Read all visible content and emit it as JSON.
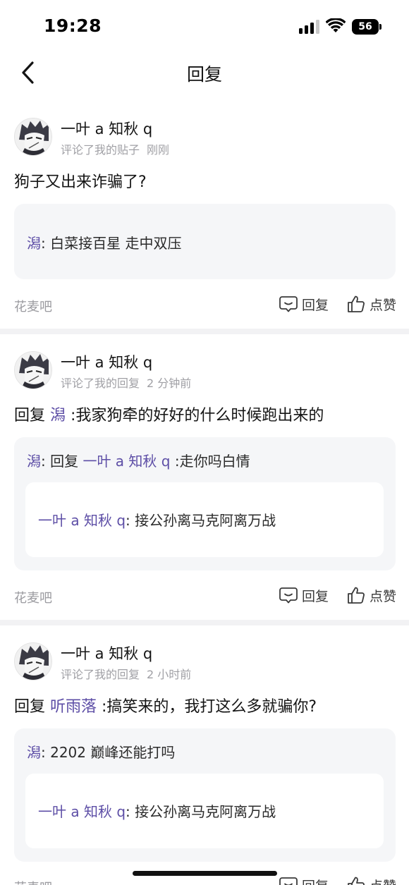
{
  "status_bar": {
    "time": "19:28",
    "battery": "56"
  },
  "nav": {
    "title": "回复"
  },
  "notifications": [
    {
      "username": "一叶 a 知秋 q",
      "action": "评论了我的贴子",
      "time": "刚刚",
      "content_text": "狗子又出来诈骗了?",
      "quote": {
        "author": "潟",
        "text": ": 白菜接百星 走中双压"
      },
      "forum": "花麦吧",
      "reply_label": "回复",
      "like_label": "点赞"
    },
    {
      "username": "一叶 a 知秋 q",
      "action": "评论了我的回复",
      "time": "2 分钟前",
      "content_prefix": "回复 ",
      "content_mention": "潟",
      "content_text": " :我家狗牵的好好的什么时候跑出来的",
      "quote": {
        "author": "潟",
        "prefix": ": 回复 ",
        "mention": "一叶 a 知秋 q",
        "text": " :走你吗白情",
        "inner_author": "一叶 a 知秋 q",
        "inner_text": ": 接公孙离马克阿离万战"
      },
      "forum": "花麦吧",
      "reply_label": "回复",
      "like_label": "点赞"
    },
    {
      "username": "一叶 a 知秋 q",
      "action": "评论了我的回复",
      "time": "2 小时前",
      "content_prefix": "回复 ",
      "content_mention": "听雨落",
      "content_text": " :搞笑来的，我打这么多就骗你?",
      "quote": {
        "author": "潟",
        "text": ": 2202 巅峰还能打吗",
        "inner_author": "一叶 a 知秋 q",
        "inner_text": ": 接公孙离马克阿离万战"
      },
      "forum": "花麦吧",
      "reply_label": "回复",
      "like_label": "点赞"
    }
  ],
  "colors": {
    "mention": "#5d4ea6",
    "meta": "#a0a0a5",
    "quote_bg": "#f5f6f8",
    "divider": "#f2f2f4"
  },
  "icons": [
    "signal-icon",
    "wifi-icon",
    "battery-icon",
    "back-icon",
    "comment-icon",
    "thumbs-up-icon"
  ]
}
